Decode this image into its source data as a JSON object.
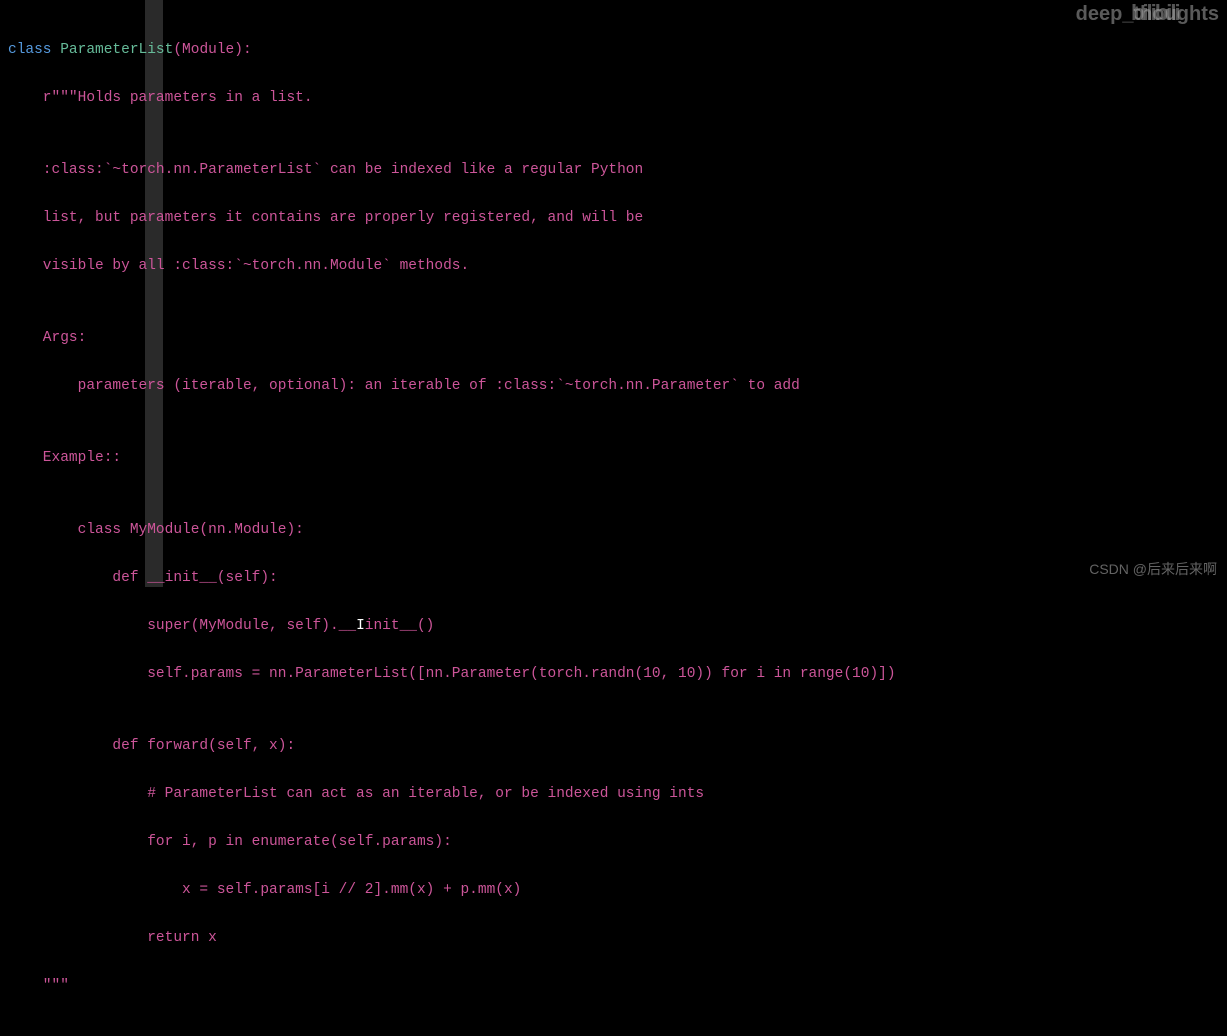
{
  "watermarks": {
    "top_text": "deep_thoughts",
    "top_logo": "bilibili",
    "bottom": "CSDN @后来后来啊"
  },
  "code": {
    "line1_kw": "class ",
    "line1_name": "ParameterList",
    "line1_rest": "(Module):",
    "line2": "    r\"\"\"Holds parameters in a list.",
    "line3": "",
    "line4": "    :class:`~torch.nn.ParameterList` can be indexed like a regular Python",
    "line5": "    list, but parameters it contains are properly registered, and will be",
    "line6": "    visible by all :class:`~torch.nn.Module` methods.",
    "line7": "",
    "line8": "    Args:",
    "line9": "        parameters (iterable, optional): an iterable of :class:`~torch.nn.Parameter` to add",
    "line10": "",
    "line11": "    Example::",
    "line12": "",
    "line13": "        class MyModule(nn.Module):",
    "line14": "            def __init__(self):",
    "line15a": "                super(MyModule, self).__",
    "line15b": "init__()",
    "line16": "                self.params = nn.ParameterList([nn.Parameter(torch.randn(10, 10)) for i in range(10)])",
    "line17": "",
    "line18": "            def forward(self, x):",
    "line19": "                # ParameterList can act as an iterable, or be indexed using ints",
    "line20": "                for i, p in enumerate(self.params):",
    "line21": "                    x = self.params[i // 2].mm(x) + p.mm(x)",
    "line22": "                return x",
    "line23": "    \"\"\""
  }
}
